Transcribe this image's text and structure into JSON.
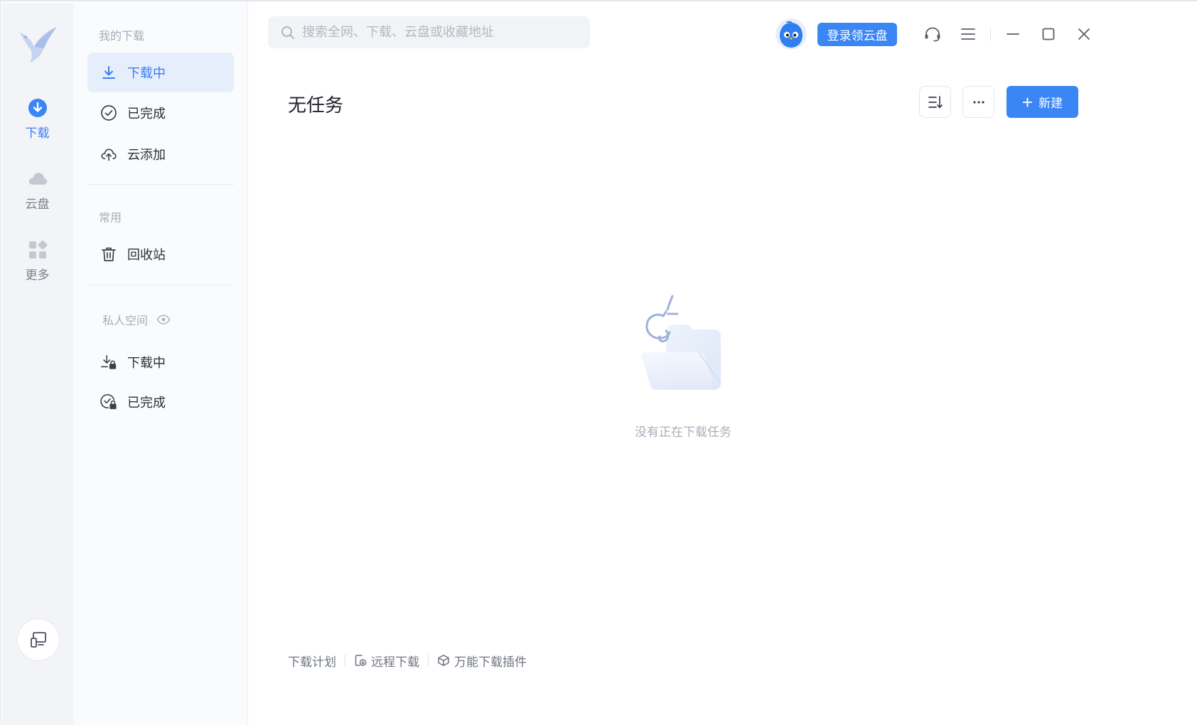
{
  "rail": {
    "items": [
      {
        "label": "下载",
        "icon": "download-icon",
        "active": true
      },
      {
        "label": "云盘",
        "icon": "cloud-icon",
        "active": false
      },
      {
        "label": "更多",
        "icon": "apps-icon",
        "active": false
      }
    ],
    "bottom_icon": "device-switch-icon"
  },
  "sidebar": {
    "my_downloads_title": "我的下载",
    "items": [
      {
        "label": "下载中",
        "icon": "download-icon",
        "active": true
      },
      {
        "label": "已完成",
        "icon": "check-circle-icon"
      },
      {
        "label": "云添加",
        "icon": "cloud-upload-icon"
      }
    ],
    "common_title": "常用",
    "common_items": [
      {
        "label": "回收站",
        "icon": "trash-icon"
      }
    ],
    "private_title": "私人空间",
    "private_items": [
      {
        "label": "下载中",
        "icon": "locked-download-icon"
      },
      {
        "label": "已完成",
        "icon": "locked-check-icon"
      }
    ]
  },
  "header": {
    "search_placeholder": "搜索全网、下载、云盘或收藏地址",
    "login_label": "登录领云盘"
  },
  "main": {
    "title": "无任务",
    "new_label": "新建",
    "empty_text": "没有正在下载任务"
  },
  "footer": {
    "links": [
      "下载计划",
      "远程下载",
      "万能下载插件"
    ]
  },
  "colors": {
    "accent": "#3a86f5",
    "active_bg": "#e6eefc"
  }
}
